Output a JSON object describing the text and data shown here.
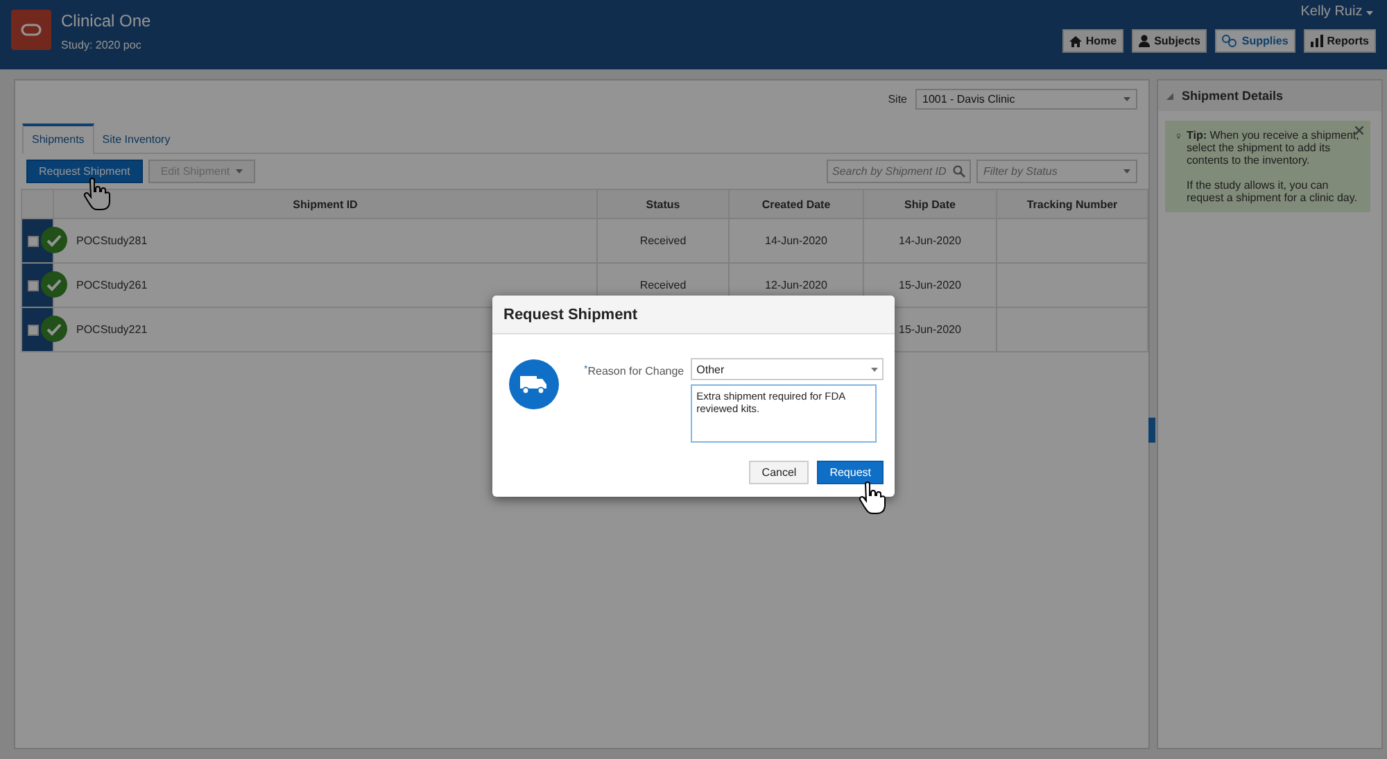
{
  "header": {
    "app_title": "Clinical One",
    "study": "Study: 2020 poc",
    "user": "Kelly Ruiz",
    "nav": [
      {
        "label": "Home",
        "selected": false
      },
      {
        "label": "Subjects",
        "selected": false
      },
      {
        "label": "Supplies",
        "selected": true
      },
      {
        "label": "Reports",
        "selected": false
      }
    ]
  },
  "site": {
    "label": "Site",
    "value": "1001 - Davis Clinic"
  },
  "tabs": [
    {
      "label": "Shipments",
      "selected": true
    },
    {
      "label": "Site Inventory",
      "selected": false
    }
  ],
  "toolbar": {
    "request_button": "Request Shipment",
    "edit_button": "Edit Shipment",
    "search_placeholder": "Search by Shipment ID",
    "filter_placeholder": "Filter by Status"
  },
  "table": {
    "columns": [
      "Shipment ID",
      "Status",
      "Created Date",
      "Ship Date",
      "Tracking Number"
    ],
    "rows": [
      {
        "checked": false,
        "cells": [
          "POCStudy281",
          "Received",
          "14-Jun-2020",
          "14-Jun-2020"
        ]
      },
      {
        "checked": false,
        "cells": [
          "POCStudy261",
          "Received",
          "12-Jun-2020",
          "15-Jun-2020"
        ]
      },
      {
        "checked": false,
        "cells": [
          "POCStudy221",
          "",
          "",
          "15-Jun-2020"
        ]
      }
    ]
  },
  "details_panel": {
    "title": "Shipment Details",
    "tip": "**Tip:** When you receive a shipment, select the shipment to add its contents to the inventory.",
    "tip_more": "If the study allows it, you can request a shipment for a clinic day."
  },
  "dialog": {
    "title": "Request Shipment",
    "required_mark": "*",
    "reason_label": "Reason for Change",
    "reason_value": "Other",
    "comment": "Extra shipment required for FDA reviewed kits.",
    "cancel": "Cancel",
    "request": "Request"
  }
}
